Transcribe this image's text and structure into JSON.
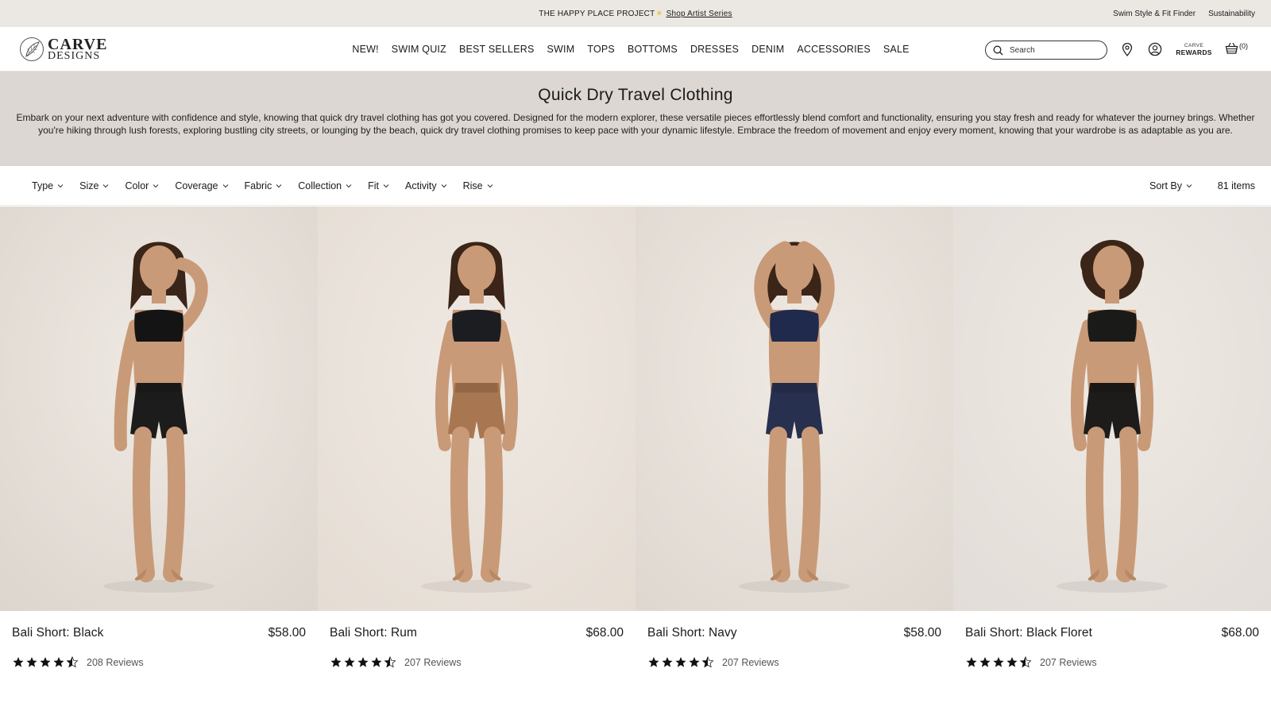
{
  "announcement": {
    "text": "THE HAPPY PLACE PROJECT",
    "link": "Shop Artist Series",
    "right_links": [
      "Swim Style & Fit Finder",
      "Sustainability"
    ]
  },
  "header": {
    "logo_line1": "CARVE",
    "logo_line2": "DESIGNS",
    "nav": [
      "NEW!",
      "SWIM QUIZ",
      "BEST SELLERS",
      "SWIM",
      "TOPS",
      "BOTTOMS",
      "DRESSES",
      "DENIM",
      "ACCESSORIES",
      "SALE"
    ],
    "search_placeholder": "Search",
    "rewards_line1": "CARVE",
    "rewards_line2": "REWARDS",
    "cart_count": "(0)"
  },
  "hero": {
    "title": "Quick Dry Travel Clothing",
    "description": "Embark on your next adventure with confidence and style, knowing that quick dry travel clothing has got you covered. Designed for the modern explorer, these versatile pieces effortlessly blend comfort and functionality, ensuring you stay fresh and ready for whatever the journey brings. Whether you're hiking through lush forests, exploring bustling city streets, or lounging by the beach, quick dry travel clothing promises to keep pace with your dynamic lifestyle. Embrace the freedom of movement and enjoy every moment, knowing that your wardrobe is as adaptable as you are."
  },
  "filters": [
    "Type",
    "Size",
    "Color",
    "Coverage",
    "Fabric",
    "Collection",
    "Fit",
    "Activity",
    "Rise"
  ],
  "sort_label": "Sort By",
  "item_count": "81 items",
  "products": [
    {
      "name": "Bali Short: Black",
      "price": "$58.00",
      "reviews": "208 Reviews",
      "rating": 4.5,
      "top_color": "#141414",
      "short_color": "#1c1c1c",
      "bg": "#ddd6cf"
    },
    {
      "name": "Bali Short: Rum",
      "price": "$68.00",
      "reviews": "207 Reviews",
      "rating": 4.5,
      "top_color": "#1b1d21",
      "short_color": "#a87650",
      "bg": "#e5ddd4"
    },
    {
      "name": "Bali Short: Navy",
      "price": "$58.00",
      "reviews": "207 Reviews",
      "rating": 4.5,
      "top_color": "#1f2a4d",
      "short_color": "#27304f",
      "bg": "#dfd8d1"
    },
    {
      "name": "Bali Short: Black Floret",
      "price": "$68.00",
      "reviews": "207 Reviews",
      "rating": 4.5,
      "top_color": "#1a1a18",
      "short_color": "#1d1c1a",
      "bg": "#e2ddd8"
    }
  ]
}
